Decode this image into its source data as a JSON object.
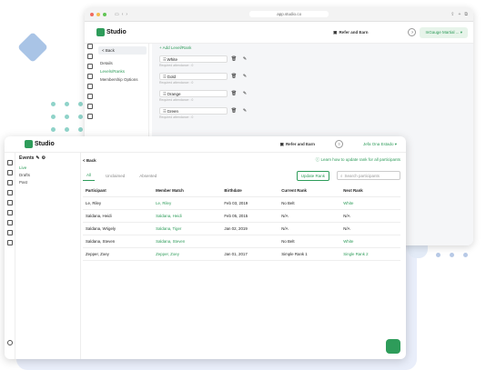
{
  "back_window": {
    "url": "app.studio.co",
    "logo": "Studio",
    "refer_label": "Refer and Earn",
    "account_label": "InGauge Martial ...",
    "nav": {
      "back": "< Back",
      "items": [
        "Details",
        "Levels/Ranks",
        "Membership Options"
      ],
      "active_index": 1
    },
    "add_rank": "+ Add Level/Rank",
    "ranks": [
      {
        "name": "White",
        "req": "Required attendance : 0"
      },
      {
        "name": "Gold",
        "req": "Required attendance : 0"
      },
      {
        "name": "Orange",
        "req": "Required attendance : 0"
      },
      {
        "name": "Green",
        "req": "Required attendance : 0"
      }
    ]
  },
  "front_window": {
    "logo": "Studio",
    "refer_label": "Refer and Earn",
    "account_label": "Jefa Ona Estado",
    "events_label": "Events",
    "nav_items": [
      "Live",
      "Drafts",
      "Past"
    ],
    "active_nav_index": 0,
    "back_label": "< Back",
    "notice": "Learn how to update rank for all participants",
    "tabs": [
      "All",
      "Unclaimed",
      "Absented"
    ],
    "active_tab": 0,
    "update_btn": "Update Rank",
    "search_placeholder": "Search participants",
    "table": {
      "columns": [
        "Participant",
        "Member Match",
        "Birthdate",
        "Current Rank",
        "Next Rank"
      ],
      "rows": [
        [
          "Le, Riley",
          "Le, Riley",
          "Feb 03, 2019",
          "No Belt",
          "White"
        ],
        [
          "Saldana, Heidi",
          "Saldana, Heidi",
          "Feb 05, 2015",
          "N/A",
          "N/A"
        ],
        [
          "Saldana, Wrigely",
          "Saldana, Tiger",
          "Jan 02, 2019",
          "N/A",
          "N/A"
        ],
        [
          "Saldana, Steven",
          "Saldana, Steven",
          "",
          "No Belt",
          "White"
        ],
        [
          "Zepper, Zoey",
          "Zepper, Zoey",
          "Jan 01, 2017",
          "Simple Rank 1",
          "Single Rank 2"
        ]
      ]
    }
  },
  "colors": {
    "brand_green": "#2e9c5a"
  }
}
